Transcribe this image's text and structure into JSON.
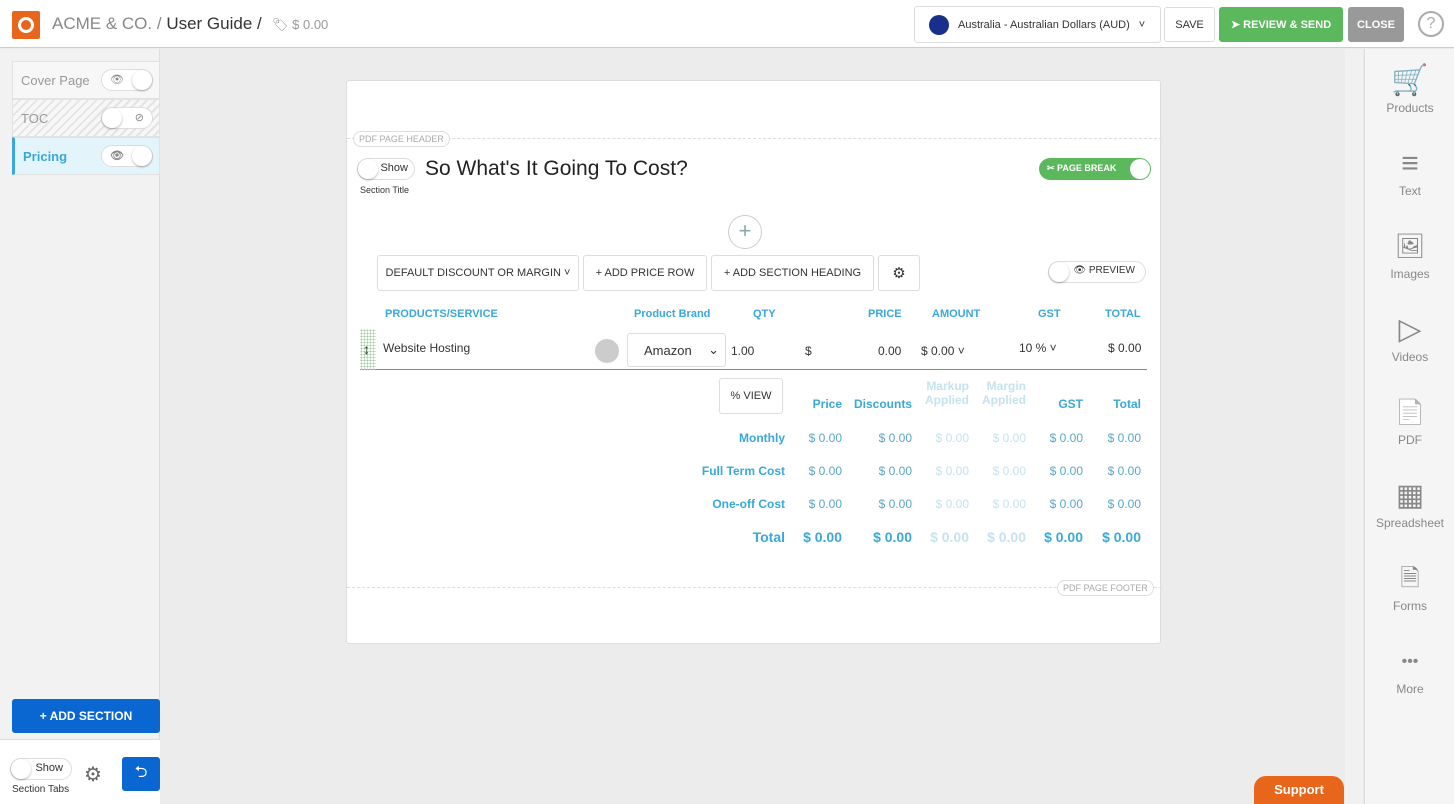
{
  "header": {
    "company": "ACME & CO. /",
    "doc": "User Guide /",
    "price": "$ 0.00",
    "currency": "Australia - Australian Dollars (AUD)",
    "save": "SAVE",
    "review": "REVIEW & SEND",
    "close": "CLOSE",
    "help": "?"
  },
  "sidebar": {
    "items": [
      {
        "label": "Cover Page"
      },
      {
        "label": "TOC"
      },
      {
        "label": "Pricing"
      }
    ],
    "add_section": "+ ADD SECTION",
    "show": "Show",
    "section_tabs": "Section Tabs"
  },
  "tools": [
    {
      "label": "Products",
      "icon": "🛒"
    },
    {
      "label": "Text",
      "icon": "≡"
    },
    {
      "label": "Images",
      "icon": "🖼"
    },
    {
      "label": "Videos",
      "icon": "▷"
    },
    {
      "label": "PDF",
      "icon": "📄"
    },
    {
      "label": "Spreadsheet",
      "icon": "▦"
    },
    {
      "label": "Forms",
      "icon": "🗎"
    },
    {
      "label": "More",
      "icon": "•••"
    }
  ],
  "page": {
    "header_pill": "PDF PAGE HEADER",
    "footer_pill": "PDF PAGE FOOTER",
    "show": "Show",
    "section_title_label": "Section Title",
    "title": "So What's It Going To Cost?",
    "page_break": "PAGE BREAK",
    "preview": "PREVIEW",
    "toolbar": {
      "discount": "DEFAULT DISCOUNT OR MARGIN ˅",
      "add_row": "+ ADD PRICE ROW",
      "add_heading": "+ ADD SECTION HEADING"
    },
    "columns": [
      "PRODUCTS/SERVICE",
      "Product Brand",
      "QTY",
      "PRICE",
      "AMOUNT",
      "GST",
      "TOTAL"
    ],
    "row": {
      "name": "Website Hosting",
      "brand": "Amazon",
      "qty": "1.00",
      "currency": "$",
      "price": "0.00",
      "amount": "$ 0.00 ˅",
      "gst": "10 % ˅",
      "total": "$ 0.00"
    },
    "pct_view": "% VIEW",
    "summary": {
      "headers": [
        "Price",
        "Discounts",
        "Markup Applied",
        "Margin Applied",
        "GST",
        "Total"
      ],
      "rows": [
        {
          "label": "Monthly",
          "values": [
            "$ 0.00",
            "$ 0.00",
            "$ 0.00",
            "$ 0.00",
            "$ 0.00",
            "$ 0.00"
          ]
        },
        {
          "label": "Full Term Cost",
          "values": [
            "$ 0.00",
            "$ 0.00",
            "$ 0.00",
            "$ 0.00",
            "$ 0.00",
            "$ 0.00"
          ]
        },
        {
          "label": "One-off Cost",
          "values": [
            "$ 0.00",
            "$ 0.00",
            "$ 0.00",
            "$ 0.00",
            "$ 0.00",
            "$ 0.00"
          ]
        },
        {
          "label": "Total",
          "values": [
            "$ 0.00",
            "$ 0.00",
            "$ 0.00",
            "$ 0.00",
            "$ 0.00",
            "$ 0.00"
          ]
        }
      ]
    }
  },
  "support": "Support",
  "colors": {
    "accent": "#3aa8d8",
    "green": "#5cb85c",
    "blue": "#0a66d0",
    "orange": "#e8661c"
  }
}
